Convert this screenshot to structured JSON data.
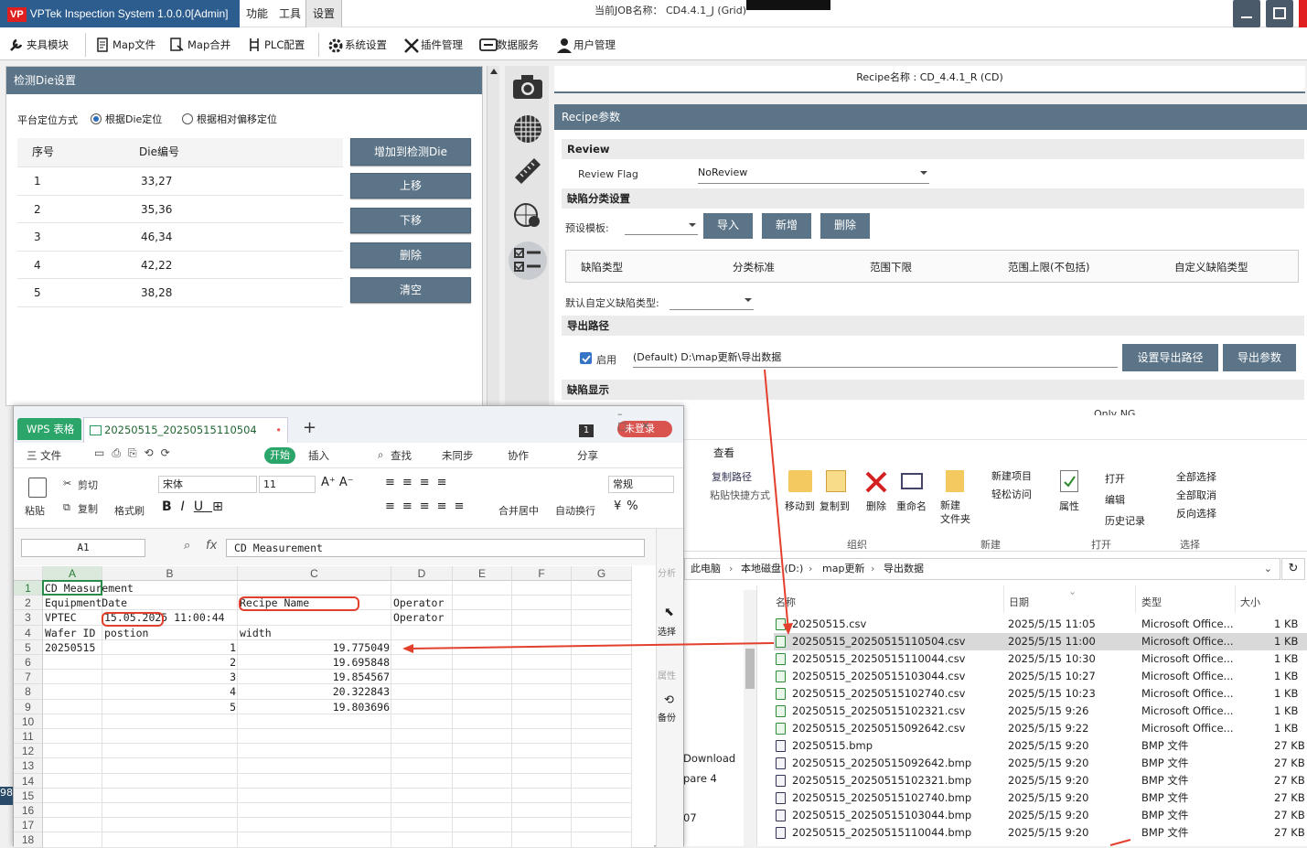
{
  "app": {
    "logo": "VP",
    "title": "VPTek Inspection System 1.0.0.0[Admin]",
    "menus": [
      "功能",
      "工具",
      "设置"
    ],
    "job_label": "当前JOB名称： CD4.4.1_J (Grid)"
  },
  "toolbar": [
    "夹具模块",
    "Map文件",
    "Map合并",
    "PLC配置",
    "系统设置",
    "插件管理",
    "数据服务",
    "用户管理"
  ],
  "left": {
    "header": "检测Die设置",
    "position_label": "平台定位方式",
    "radio_die": "根据Die定位",
    "radio_offset": "根据相对偏移定位",
    "col_index": "序号",
    "col_die": "Die编号",
    "rows": [
      {
        "n": "1",
        "die": "33,27"
      },
      {
        "n": "2",
        "die": "35,36"
      },
      {
        "n": "3",
        "die": "46,34"
      },
      {
        "n": "4",
        "die": "42,22"
      },
      {
        "n": "5",
        "die": "38,28"
      }
    ],
    "buttons": [
      "增加到检测Die",
      "上移",
      "下移",
      "删除",
      "清空"
    ]
  },
  "recipe": {
    "name": "Recipe名称 : CD_4.4.1_R (CD)",
    "header": "Recipe参数",
    "review": "Review",
    "review_flag_label": "Review Flag",
    "review_flag_value": "NoReview",
    "defect_section": "缺陷分类设置",
    "preset_label": "预设模板:",
    "btn_import": "导入",
    "btn_new": "新增",
    "btn_delete": "删除",
    "defect_cols": [
      "缺陷类型",
      "分类标准",
      "范围下限",
      "范围上限(不包括)",
      "自定义缺陷类型"
    ],
    "default_label": "默认自定义缺陷类型:",
    "export_section": "导出路径",
    "enable_label": "启用",
    "export_path": "(Default) D:\\map更新\\导出数据",
    "btn_set_path": "设置导出路径",
    "btn_export": "导出参数",
    "display_section": "缺陷显示",
    "display_partial": "Only NG"
  },
  "wps": {
    "app_name": "WPS 表格",
    "doc_tab": "20250515_20250515110504",
    "login": "未登录",
    "badge": "1",
    "menu": [
      "三 文件",
      "开始",
      "插入",
      "查找",
      "未同步",
      "协作",
      "分享"
    ],
    "ribbon": {
      "paste": "粘贴",
      "cut": "剪切",
      "copy": "复制",
      "format_painter": "格式刷",
      "font": "宋体",
      "size": "11",
      "merge": "合并居中",
      "wrap": "自动换行",
      "number_format": "常规"
    },
    "cell_ref": "A1",
    "fx": "fx",
    "formula": "CD Measurement",
    "cols": [
      "A",
      "B",
      "C",
      "D",
      "E",
      "F",
      "G"
    ],
    "rows": [
      "1",
      "2",
      "3",
      "4",
      "5",
      "6",
      "7",
      "8",
      "9",
      "10",
      "11",
      "12",
      "13",
      "14",
      "15",
      "16",
      "17",
      "18"
    ],
    "cells": {
      "a1": "CD Measurement",
      "a2": "EquipmentDate",
      "c2": "Recipe Name",
      "d2": "Operator",
      "a3": "VPTEC",
      "b3": "15.05.2025 11:00:44",
      "d3": "Operator",
      "a4": "Wafer ID",
      "b4": "postion",
      "c4": "width",
      "a5": "20250515",
      "b5": "1",
      "c5": "19.775049",
      "b6": "2",
      "c6": "19.695848",
      "b7": "3",
      "c7": "19.854567",
      "b8": "4",
      "c8": "20.322843",
      "b9": "5",
      "c9": "19.803696"
    },
    "side": [
      "分析",
      "选择",
      "属性",
      "备份"
    ]
  },
  "explorer": {
    "ribbon": {
      "copy_path": "复制路径",
      "paste_shortcut": "粘贴快捷方式",
      "move_to": "移动到",
      "copy_to": "复制到",
      "delete": "删除",
      "rename": "重命名",
      "new_folder": "新建\n文件夹",
      "new_item": "新建项目",
      "easy_access": "轻松访问",
      "properties": "属性",
      "open": "打开",
      "edit": "编辑",
      "history": "历史记录",
      "select_all": "全部选择",
      "select_none": "全部取消",
      "invert": "反向选择",
      "view": "查看"
    },
    "groups": [
      "组织",
      "新建",
      "打开",
      "选择"
    ],
    "breadcrumb": [
      "此电脑",
      "本地磁盘 (D:)",
      "map更新",
      "导出数据"
    ],
    "cols": [
      "名称",
      "日期",
      "类型",
      "大小"
    ],
    "nav": [
      "Download",
      "pare 4",
      "07"
    ],
    "files": [
      {
        "name": "20250515.csv",
        "date": "2025/5/15 11:05",
        "type": "Microsoft Office...",
        "size": "1 KB",
        "kind": "csv"
      },
      {
        "name": "20250515_20250515110504.csv",
        "date": "2025/5/15 11:00",
        "type": "Microsoft Office...",
        "size": "1 KB",
        "kind": "csv"
      },
      {
        "name": "20250515_20250515110044.csv",
        "date": "2025/5/15 10:30",
        "type": "Microsoft Office...",
        "size": "1 KB",
        "kind": "csv"
      },
      {
        "name": "20250515_20250515103044.csv",
        "date": "2025/5/15 10:27",
        "type": "Microsoft Office...",
        "size": "1 KB",
        "kind": "csv"
      },
      {
        "name": "20250515_20250515102740.csv",
        "date": "2025/5/15 10:23",
        "type": "Microsoft Office...",
        "size": "1 KB",
        "kind": "csv"
      },
      {
        "name": "20250515_20250515102321.csv",
        "date": "2025/5/15 9:26",
        "type": "Microsoft Office...",
        "size": "1 KB",
        "kind": "csv"
      },
      {
        "name": "20250515_20250515092642.csv",
        "date": "2025/5/15 9:22",
        "type": "Microsoft Office...",
        "size": "1 KB",
        "kind": "csv"
      },
      {
        "name": "20250515.bmp",
        "date": "2025/5/15 9:20",
        "type": "BMP 文件",
        "size": "27 KB",
        "kind": "bmp"
      },
      {
        "name": "20250515_20250515092642.bmp",
        "date": "2025/5/15 9:20",
        "type": "BMP 文件",
        "size": "27 KB",
        "kind": "bmp"
      },
      {
        "name": "20250515_20250515102321.bmp",
        "date": "2025/5/15 9:20",
        "type": "BMP 文件",
        "size": "27 KB",
        "kind": "bmp"
      },
      {
        "name": "20250515_20250515102740.bmp",
        "date": "2025/5/15 9:20",
        "type": "BMP 文件",
        "size": "27 KB",
        "kind": "bmp"
      },
      {
        "name": "20250515_20250515103044.bmp",
        "date": "2025/5/15 9:20",
        "type": "BMP 文件",
        "size": "27 KB",
        "kind": "bmp"
      },
      {
        "name": "20250515_20250515110044.bmp",
        "date": "2025/5/15 9:20",
        "type": "BMP 文件",
        "size": "27 KB",
        "kind": "bmp"
      }
    ]
  },
  "misc": {
    "left_edge": "98"
  }
}
